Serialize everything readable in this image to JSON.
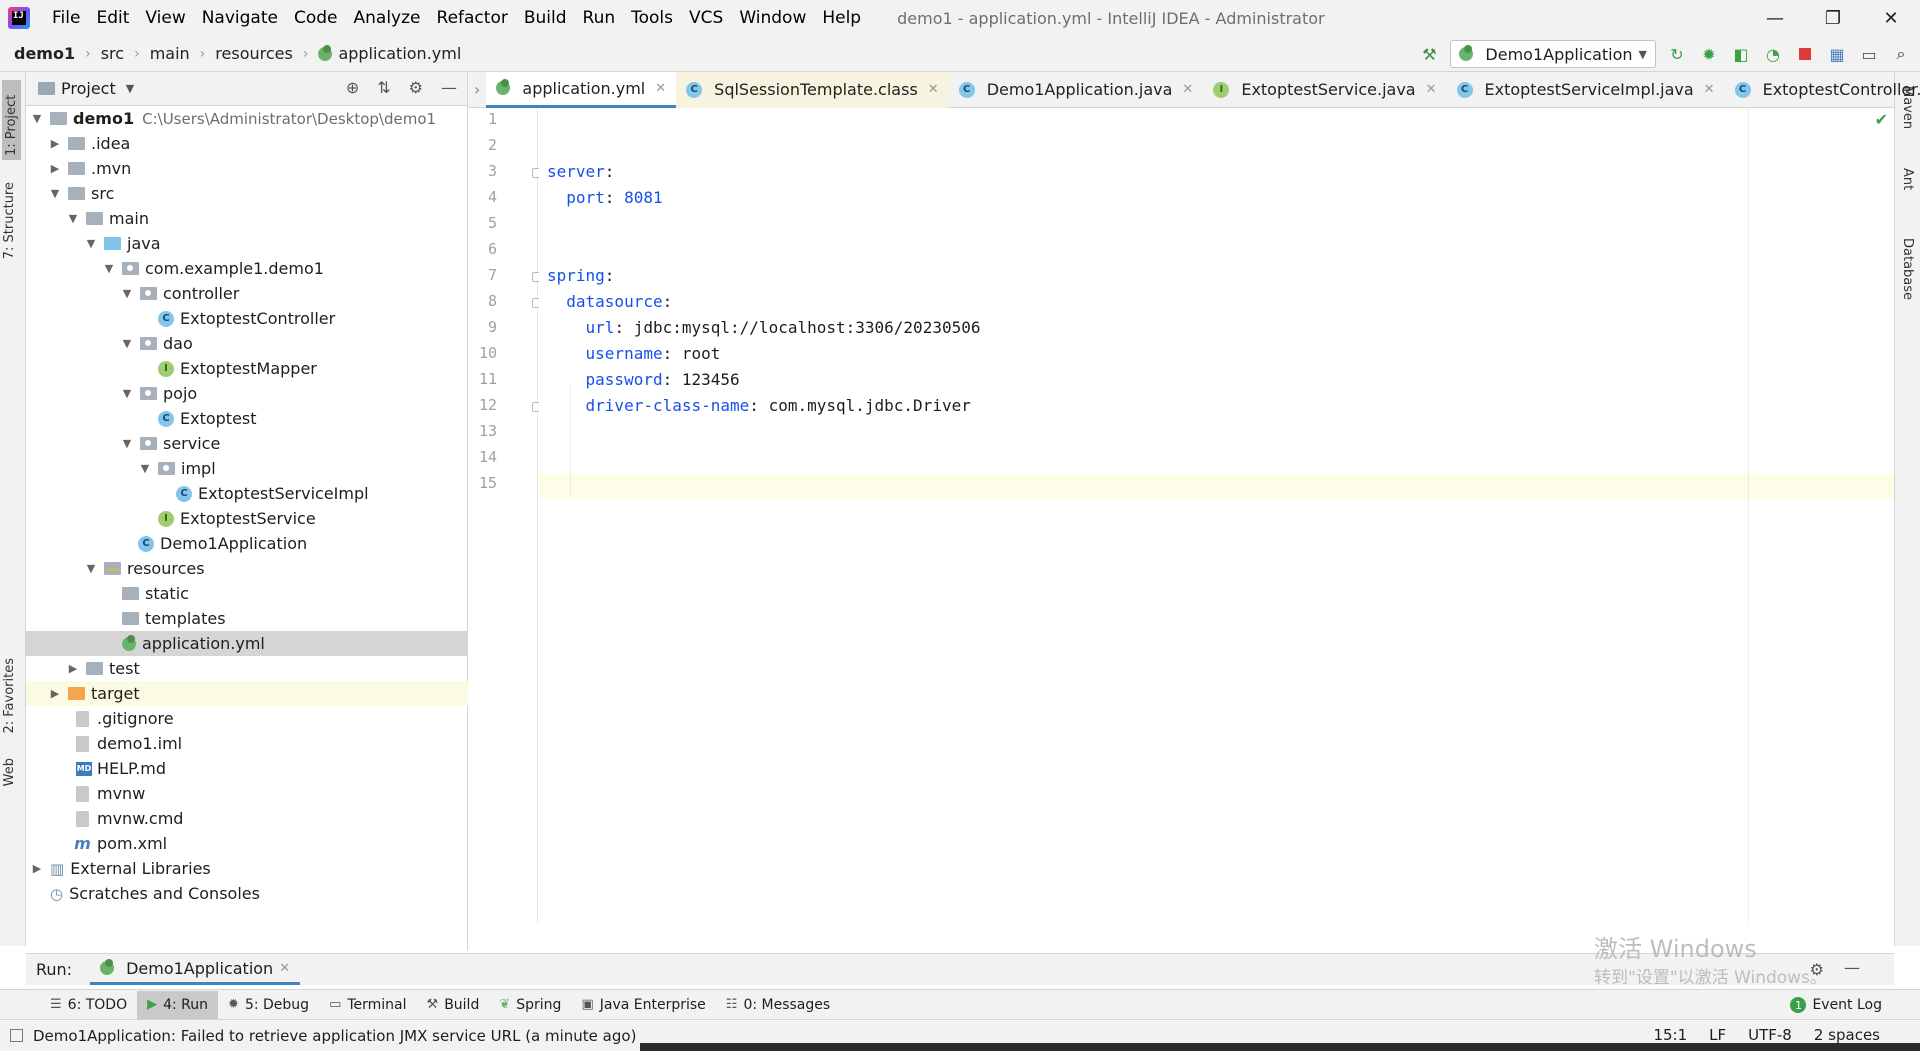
{
  "window": {
    "title": "demo1 - application.yml - IntelliJ IDEA - Administrator",
    "minimize": "—",
    "restore": "❐",
    "close": "✕"
  },
  "menu": [
    "File",
    "Edit",
    "View",
    "Navigate",
    "Code",
    "Analyze",
    "Refactor",
    "Build",
    "Run",
    "Tools",
    "VCS",
    "Window",
    "Help"
  ],
  "breadcrumb": [
    "demo1",
    "src",
    "main",
    "resources",
    "application.yml"
  ],
  "run_config": "Demo1Application",
  "left_stripe": {
    "project": "1: Project",
    "structure": "7: Structure",
    "favorites": "2: Favorites",
    "web": "Web"
  },
  "right_stripe": {
    "maven": "Maven",
    "ant": "Ant",
    "database": "Database"
  },
  "project_panel": {
    "title": "Project",
    "tree": [
      {
        "label": "demo1",
        "path": "C:\\Users\\Administrator\\Desktop\\demo1",
        "bold": true
      },
      {
        "label": ".idea"
      },
      {
        "label": ".mvn"
      },
      {
        "label": "src"
      },
      {
        "label": "main"
      },
      {
        "label": "java"
      },
      {
        "label": "com.example1.demo1"
      },
      {
        "label": "controller"
      },
      {
        "label": "ExtoptestController"
      },
      {
        "label": "dao"
      },
      {
        "label": "ExtoptestMapper"
      },
      {
        "label": "pojo"
      },
      {
        "label": "Extoptest"
      },
      {
        "label": "service"
      },
      {
        "label": "impl"
      },
      {
        "label": "ExtoptestServiceImpl"
      },
      {
        "label": "ExtoptestService"
      },
      {
        "label": "Demo1Application"
      },
      {
        "label": "resources"
      },
      {
        "label": "static"
      },
      {
        "label": "templates"
      },
      {
        "label": "application.yml"
      },
      {
        "label": "test"
      },
      {
        "label": "target"
      },
      {
        "label": ".gitignore"
      },
      {
        "label": "demo1.iml"
      },
      {
        "label": "HELP.md"
      },
      {
        "label": "mvnw"
      },
      {
        "label": "mvnw.cmd"
      },
      {
        "label": "pom.xml"
      },
      {
        "label": "External Libraries"
      },
      {
        "label": "Scratches and Consoles"
      }
    ]
  },
  "editor_tabs": [
    {
      "label": "application.yml",
      "icon": "yml-icon",
      "active": true
    },
    {
      "label": "SqlSessionTemplate.class",
      "icon": "class-icon"
    },
    {
      "label": "Demo1Application.java",
      "icon": "class-icon"
    },
    {
      "label": "ExtoptestService.java",
      "icon": "interface-icon"
    },
    {
      "label": "ExtoptestServiceImpl.java",
      "icon": "class-icon"
    },
    {
      "label": "ExtoptestController.java",
      "icon": "class-icon"
    }
  ],
  "code": {
    "line_numbers": [
      "1",
      "2",
      "3",
      "4",
      "5",
      "6",
      "7",
      "8",
      "9",
      "10",
      "11",
      "12",
      "13",
      "14",
      "15"
    ],
    "server_key": "server",
    "port_key": "port",
    "port_value": "8081",
    "spring_key": "spring",
    "datasource_key": "datasource",
    "url_key": "url",
    "url_value": "jdbc:mysql://localhost:3306/20230506",
    "username_key": "username",
    "username_value": "root",
    "password_key": "password",
    "password_value": "123456",
    "driver_key": "driver-class-name",
    "driver_value": "com.mysql.jdbc.Driver"
  },
  "run_panel": {
    "label": "Run:",
    "tab": "Demo1Application"
  },
  "watermark": {
    "line1": "激活 Windows",
    "line2": "转到\"设置\"以激活 Windows。"
  },
  "tool_windows": [
    {
      "label": "6: TODO",
      "icon": "todo-icon"
    },
    {
      "label": "4: Run",
      "icon": "run-icon",
      "active": true
    },
    {
      "label": "5: Debug",
      "icon": "debug-icon"
    },
    {
      "label": "Terminal",
      "icon": "terminal-icon"
    },
    {
      "label": "Build",
      "icon": "build-icon"
    },
    {
      "label": "Spring",
      "icon": "spring-icon"
    },
    {
      "label": "Java Enterprise",
      "icon": "java-enterprise-icon"
    },
    {
      "label": "0: Messages",
      "icon": "messages-icon"
    }
  ],
  "event_log": "Event Log",
  "status": {
    "message": "Demo1Application: Failed to retrieve application JMX service URL (a minute ago)",
    "position": "15:1",
    "line_sep": "LF",
    "encoding": "UTF-8",
    "indent": "2 spaces"
  }
}
